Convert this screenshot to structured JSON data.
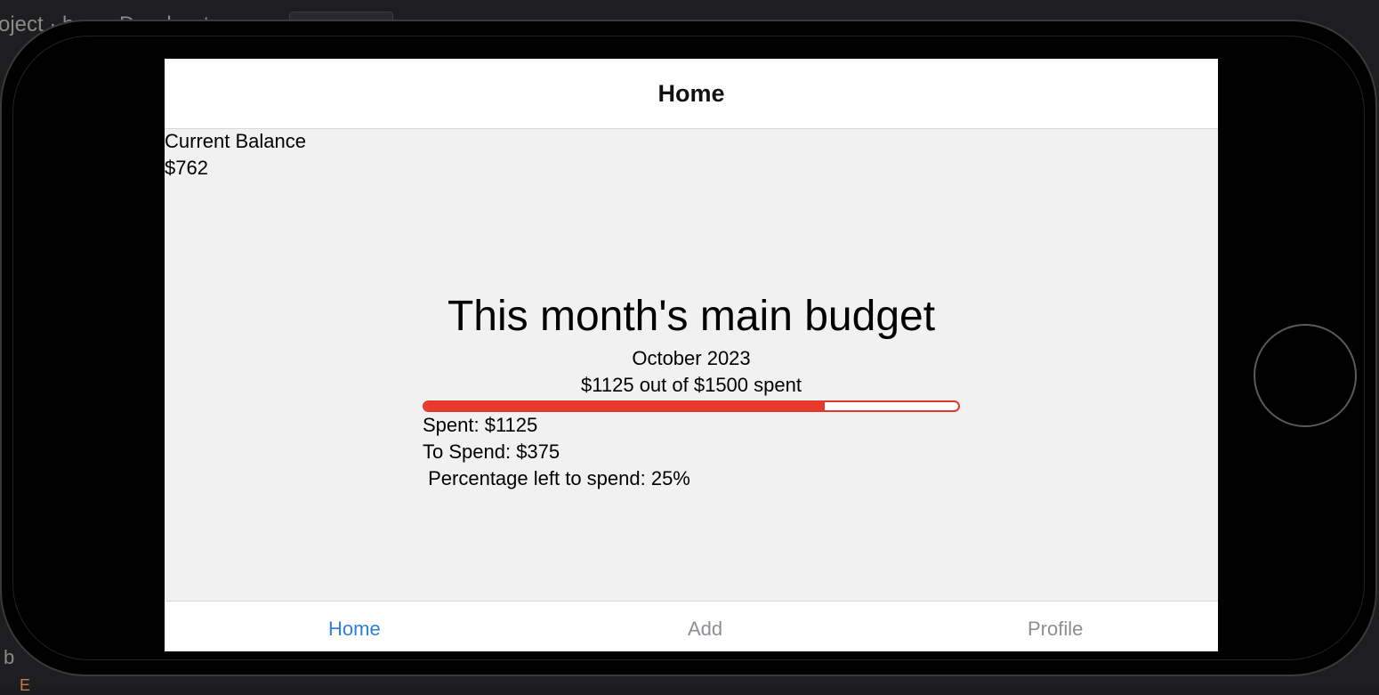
{
  "ide": {
    "top_text": "oject · b · · · D · · l · · t",
    "bottom_text": "b",
    "bottom_text2": "E"
  },
  "navbar": {
    "title": "Home"
  },
  "balance": {
    "label": "Current Balance",
    "value": "$762"
  },
  "budget": {
    "title": "This month's main budget",
    "month": "October 2023",
    "summary": "$1125 out of $1500 spent",
    "progress_fraction": 0.75,
    "progress_color": "#e83a2c",
    "spent": "Spent: $1125",
    "to_spend": "To Spend: $375",
    "percentage_left": " Percentage left to spend: 25%"
  },
  "tabbar": {
    "home": "Home",
    "add": "Add",
    "profile": "Profile",
    "active_color": "#2f7fe0",
    "inactive_color": "#8e8e93"
  }
}
